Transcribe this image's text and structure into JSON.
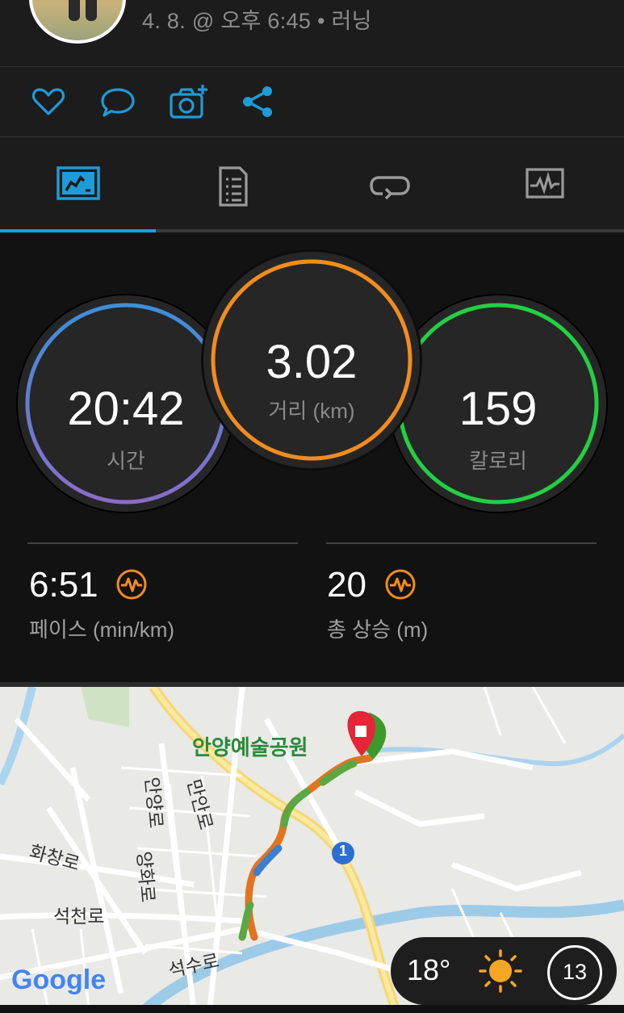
{
  "activity": {
    "subtitle": "4. 8. @ 오후 6:45 • 러닝"
  },
  "actions": [
    {
      "name": "like",
      "icon": "heart-icon"
    },
    {
      "name": "comment",
      "icon": "comment-icon"
    },
    {
      "name": "add-photo",
      "icon": "camera-plus-icon"
    },
    {
      "name": "share",
      "icon": "share-icon"
    }
  ],
  "tabs": [
    {
      "icon": "stats-overview-icon",
      "active": true
    },
    {
      "icon": "details-list-icon",
      "active": false
    },
    {
      "icon": "laps-icon",
      "active": false
    },
    {
      "icon": "charts-icon",
      "active": false
    }
  ],
  "rings": {
    "time": {
      "value": "20:42",
      "label": "시간"
    },
    "distance": {
      "value": "3.02",
      "label": "거리 (km)"
    },
    "calories": {
      "value": "159",
      "label": "칼로리"
    }
  },
  "metrics": {
    "pace": {
      "value": "6:51",
      "label": "페이스 (min/km)",
      "icon": "chart-pulse-icon"
    },
    "ascent": {
      "value": "20",
      "label": "총 상승 (m)",
      "icon": "chart-pulse-icon"
    }
  },
  "map": {
    "place_label": "안양예술공원",
    "roads": [
      "안양로",
      "만안로",
      "화창로",
      "양화로",
      "석천로",
      "석수로"
    ],
    "route_badge": "1",
    "logo": "Google"
  },
  "weather": {
    "temperature": "18°",
    "condition_icon": "sun-icon",
    "wind": "13"
  },
  "colors": {
    "accent": "#1e9bd8",
    "time_ring_top": "#3d8fd8",
    "time_ring_bottom": "#8a6cc8",
    "distance_ring": "#f28c1e",
    "calories_ring": "#23d043",
    "metric_icon": "#f28c1e"
  }
}
